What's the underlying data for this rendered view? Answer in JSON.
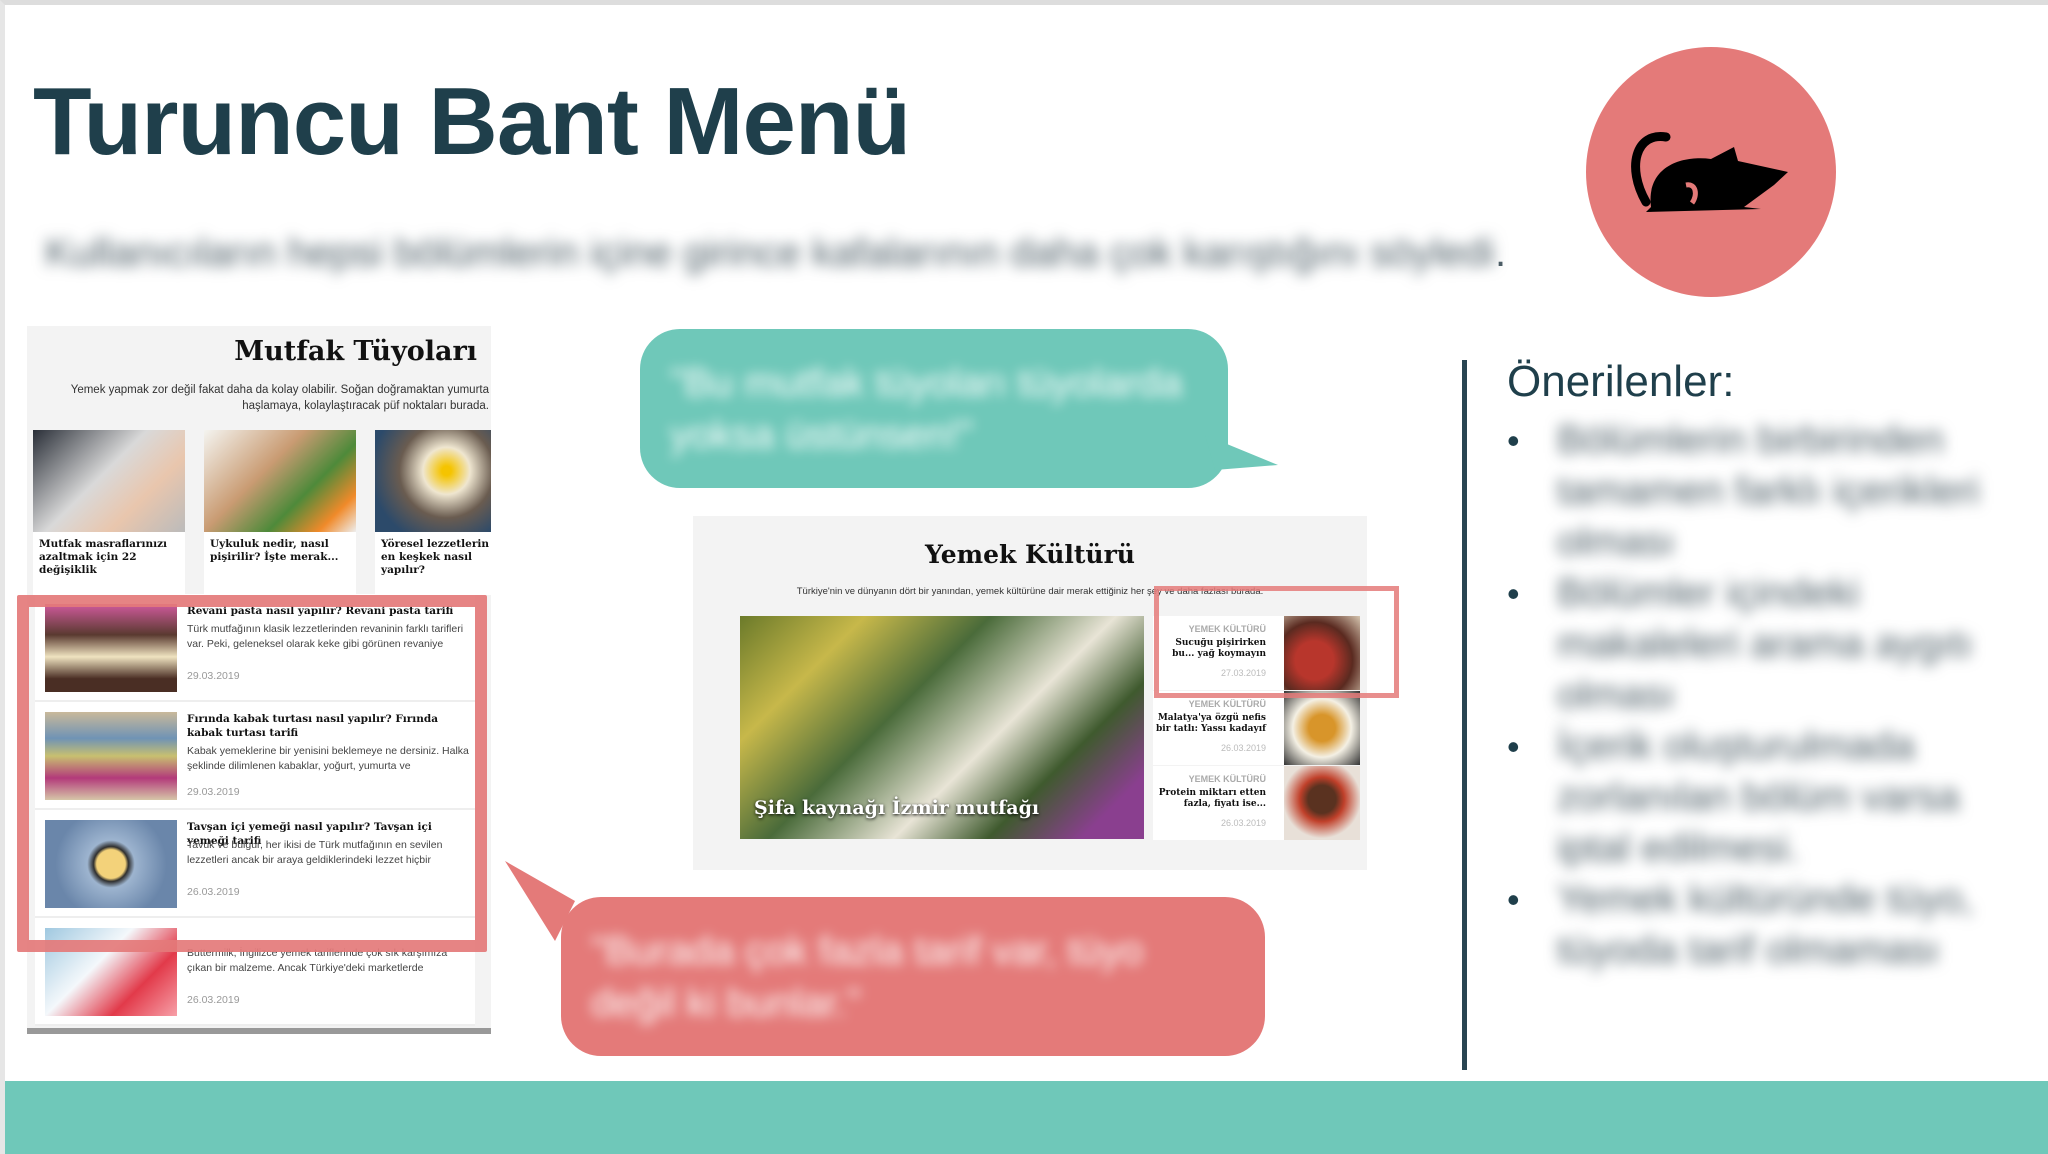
{
  "slide": {
    "title": "Turuncu Bant Menü",
    "subtitle": "Kullanıcıların hepsi bölümlerin içine girince kafalarının daha çok karıştığını söyledi",
    "subtitle_end": ".",
    "mascot_icon": "rat-icon",
    "colors": {
      "title": "#1f3f4b",
      "accent_red": "#e47a79",
      "accent_teal": "#6fc8b9"
    }
  },
  "left_panel": {
    "title": "Mutfak Tüyoları",
    "description": "Yemek yapmak zor değil fakat daha da kolay olabilir. Soğan doğramaktan yumurta haşlamaya, kolaylaştıracak püf noktaları burada.",
    "cards": [
      {
        "caption": "Mutfak masraflarınızı azaltmak için 22 değişiklik"
      },
      {
        "caption": "Uykuluk nedir, nasıl pişirilir? İşte merak..."
      },
      {
        "caption": "Yöresel lezzetlerin en keşkek nasıl yapılır?"
      }
    ],
    "articles": [
      {
        "title": "Revani pasta nasıl yapılır? Revani pasta tarifi",
        "desc": "Türk mutfağının klasik lezzetlerinden revaninin farklı tarifleri var. Peki, geleneksel olarak keke gibi görünen revaniye",
        "date": "29.03.2019"
      },
      {
        "title": "Fırında kabak turtası nasıl yapılır? Fırında kabak turtası tarifi",
        "desc": "Kabak yemeklerine bir yenisini beklemeye ne dersiniz. Halka şeklinde dilimlenen kabaklar, yoğurt, yumurta ve",
        "date": "29.03.2019"
      },
      {
        "title": "Tavşan içi yemeği nasıl yapılır? Tavşan içi yemeği tarifi",
        "desc": "Tavuk ve bulgur, her ikisi de Türk mutfağının en sevilen lezzetleri ancak bir araya geldiklerindeki lezzet hiçbir",
        "date": "26.03.2019"
      },
      {
        "title": "",
        "desc": "Buttermilk, İngilizce yemek tariflerinde çok sık karşımıza çıkan bir malzeme. Ancak Türkiye'deki marketlerde",
        "date": "26.03.2019"
      }
    ]
  },
  "middle_panel": {
    "title": "Yemek Kültürü",
    "description": "Türkiye'nin ve dünyanın dört bir yanından, yemek kültürüne dair merak ettiğiniz her şey ve daha fazlası burada.",
    "hero_caption": "Şifa kaynağı İzmir mutfağı",
    "side_items": [
      {
        "category": "YEMEK KÜLTÜRÜ",
        "title": "Sucuğu pişirirken bu... yağ koymayın",
        "date": "27.03.2019"
      },
      {
        "category": "YEMEK KÜLTÜRÜ",
        "title": "Malatya'ya özgü nefis bir tatlı: Yassı kadayıf",
        "date": "26.03.2019"
      },
      {
        "category": "YEMEK KÜLTÜRÜ",
        "title": "Protein miktarı etten fazla, fiyatı ise...",
        "date": "26.03.2019"
      }
    ]
  },
  "bubbles": {
    "teal": "\"Bu mutfak tüyoları tüyolarda yoksa üstünsen!\"",
    "red": "\"Burada çok fazla tarif var, tüyo değil ki bunlar.\""
  },
  "recommendations": {
    "title": "Önerilenler:",
    "items": [
      "Bölümlerin birbirinden tamamen farklı içerikleri olması",
      "Bölümler içindeki makaleleri arama aygıtı olması",
      "İçerik oluşturulmada zorlanılan bölüm varsa iptal edilmesi.",
      "Yemek kültüründe tüyo, tüyoda tarif olmaması"
    ]
  }
}
